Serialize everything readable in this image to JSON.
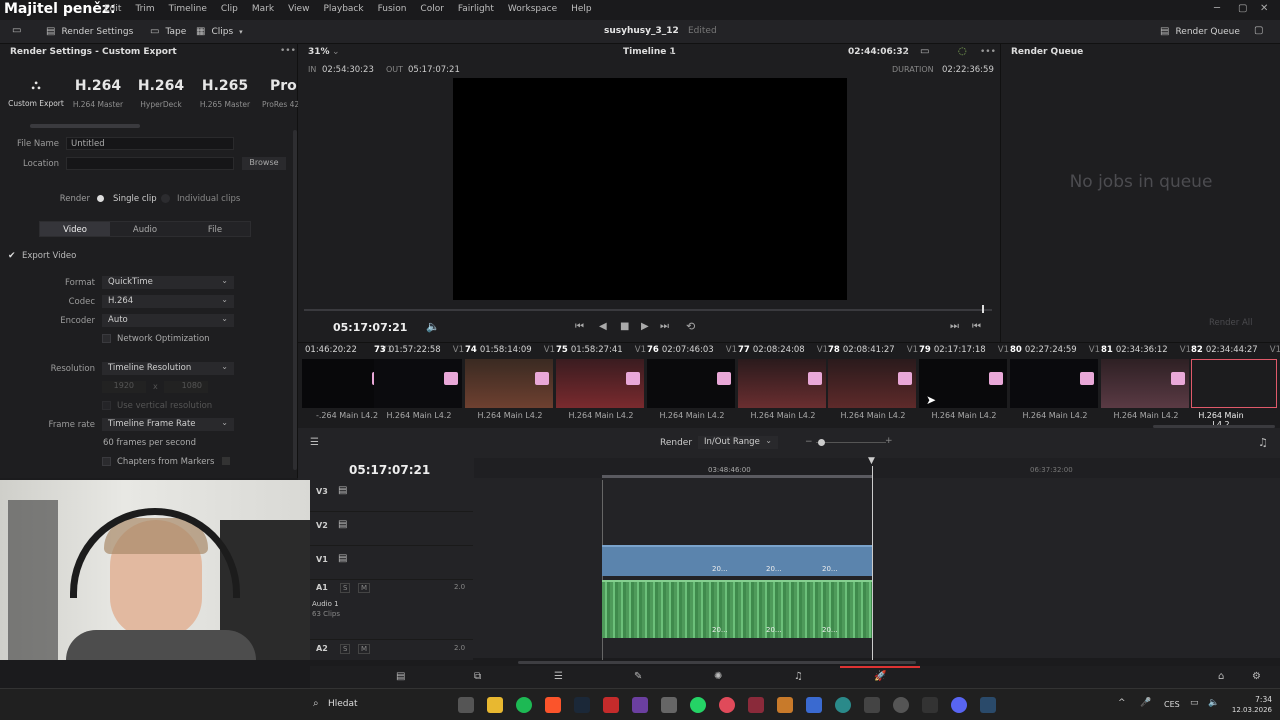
{
  "app": {
    "overlay_title": "Majitel peněz:",
    "menu": [
      "Edit",
      "Trim",
      "Timeline",
      "Clip",
      "Mark",
      "View",
      "Playback",
      "Fusion",
      "Color",
      "Fairlight",
      "Workspace",
      "Help"
    ]
  },
  "toolbar": {
    "render_settings": "Render Settings",
    "tape": "Tape",
    "clips": "Clips",
    "project_name": "susyhusy_3_12",
    "project_status": "Edited",
    "render_queue": "Render Queue"
  },
  "render_settings": {
    "title": "Render Settings - Custom Export",
    "presets": [
      {
        "big": "",
        "label": "Custom Export",
        "icon": "custom-export-icon"
      },
      {
        "big": "H.264",
        "label": "H.264 Master"
      },
      {
        "big": "H.264",
        "label": "HyperDeck"
      },
      {
        "big": "H.265",
        "label": "H.265 Master"
      },
      {
        "big": "ProRe",
        "label": "ProRes 42"
      }
    ],
    "file_name_label": "File Name",
    "file_name_value": "Untitled",
    "location_label": "Location",
    "browse": "Browse",
    "render_label": "Render",
    "single_clip": "Single clip",
    "individual_clips": "Individual clips",
    "tabs": [
      "Video",
      "Audio",
      "File"
    ],
    "export_video": "Export Video",
    "format_label": "Format",
    "format_value": "QuickTime",
    "codec_label": "Codec",
    "codec_value": "H.264",
    "encoder_label": "Encoder",
    "encoder_value": "Auto",
    "network_opt": "Network Optimization",
    "resolution_label": "Resolution",
    "resolution_value": "Timeline Resolution",
    "res_w": "1920",
    "res_x": "x",
    "res_h": "1080",
    "vertical_res": "Use vertical resolution",
    "frame_rate_label": "Frame rate",
    "frame_rate_value": "Timeline Frame Rate",
    "fps_note": "60 frames per second",
    "chapters": "Chapters from Markers"
  },
  "viewer": {
    "zoom": "31%",
    "timeline_name": "Timeline 1",
    "timecode_top": "02:44:06:32",
    "in_label": "IN",
    "in_tc": "02:54:30:23",
    "out_label": "OUT",
    "out_tc": "05:17:07:21",
    "duration_label": "DURATION",
    "duration_tc": "02:22:36:59",
    "current_tc": "05:17:07:21"
  },
  "render_queue": {
    "title": "Render Queue",
    "empty": "No jobs in queue",
    "render_all": "Render All"
  },
  "clips": [
    {
      "num": "",
      "tc": "01:46:20:22",
      "track": "V1",
      "codec": "-.264 Main L4.2"
    },
    {
      "num": "73",
      "tc": "01:57:22:58",
      "track": "V1",
      "codec": "H.264 Main L4.2"
    },
    {
      "num": "74",
      "tc": "01:58:14:09",
      "track": "V1",
      "codec": "H.264 Main L4.2"
    },
    {
      "num": "75",
      "tc": "01:58:27:41",
      "track": "V1",
      "codec": "H.264 Main L4.2"
    },
    {
      "num": "76",
      "tc": "02:07:46:03",
      "track": "V1",
      "codec": "H.264 Main L4.2"
    },
    {
      "num": "77",
      "tc": "02:08:24:08",
      "track": "V1",
      "codec": "H.264 Main L4.2"
    },
    {
      "num": "78",
      "tc": "02:08:41:27",
      "track": "V1",
      "codec": "H.264 Main L4.2"
    },
    {
      "num": "79",
      "tc": "02:17:17:18",
      "track": "V1",
      "codec": "H.264 Main L4.2"
    },
    {
      "num": "80",
      "tc": "02:27:24:59",
      "track": "V1",
      "codec": "H.264 Main L4.2"
    },
    {
      "num": "81",
      "tc": "02:34:36:12",
      "track": "V1",
      "codec": "H.264 Main L4.2"
    },
    {
      "num": "82",
      "tc": "02:34:44:27",
      "track": "V1",
      "codec": "H.264 Main L4.2"
    }
  ],
  "timeline": {
    "render_label": "Render",
    "render_range": "In/Out Range",
    "timecode": "05:17:07:21",
    "ruler_1": "03:48:46:00",
    "ruler_2": "06:37:32:00",
    "tracks": {
      "v3": "V3",
      "v2": "V2",
      "v1": "V1",
      "a1": "A1",
      "a1_name": "Audio 1",
      "a1_clips": "63 Clips",
      "a1_level": "2.0",
      "a2": "A2",
      "a2_level": "2.0",
      "s": "S",
      "m": "M"
    },
    "clip_label": "20..."
  },
  "taskbar": {
    "search": "Hledat",
    "lang": "CES",
    "time": "7:34",
    "date": "12.03.2026"
  }
}
